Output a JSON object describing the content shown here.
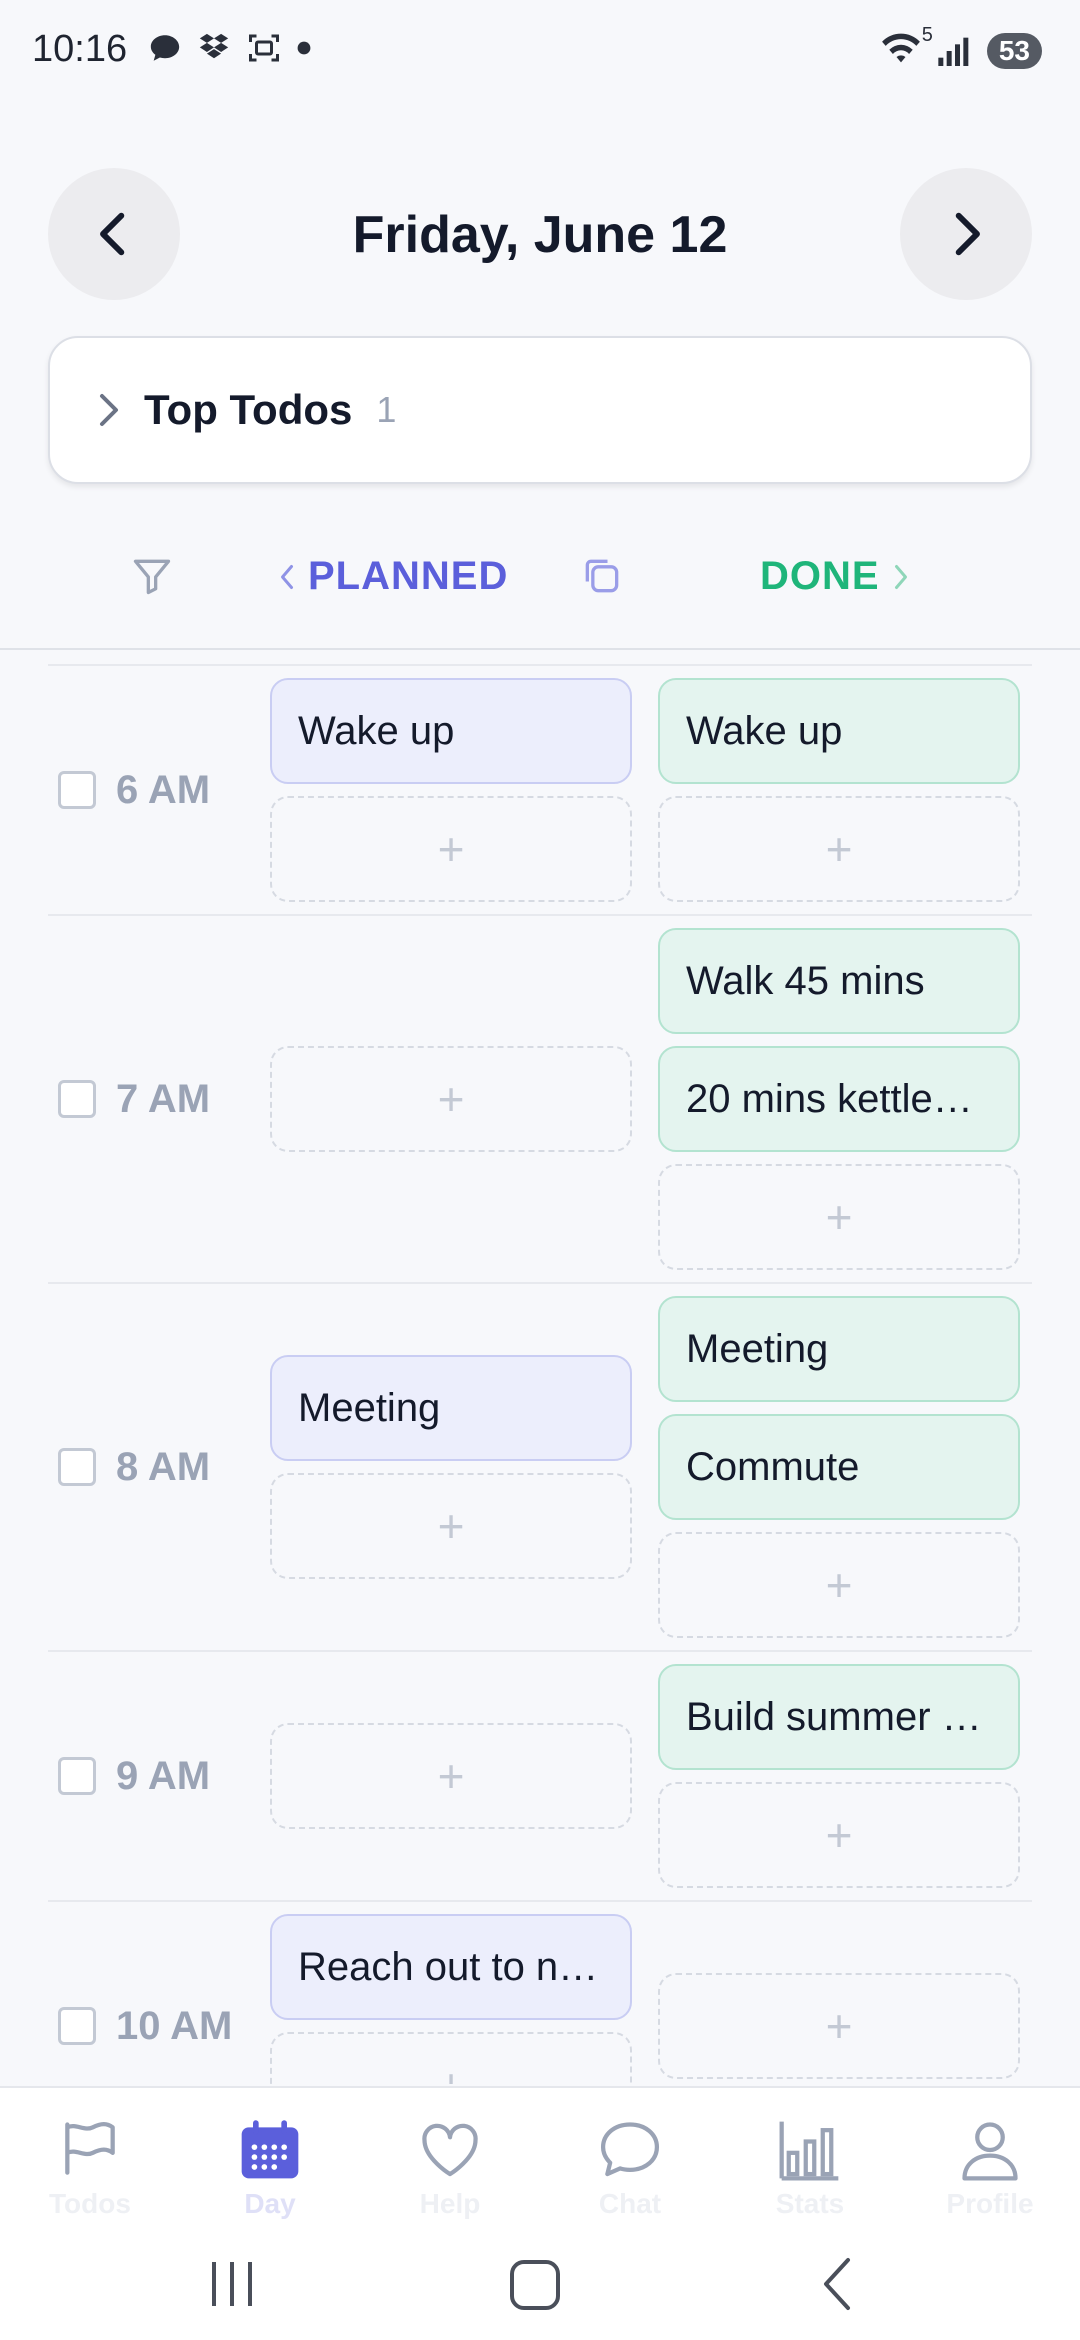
{
  "status_bar": {
    "time": "10:16",
    "battery": "53",
    "icons_left": [
      "chat-bubble-icon",
      "dropbox-icon",
      "screenshot-icon",
      "dot-icon"
    ],
    "icons_right": [
      "wifi-icon",
      "signal-icon",
      "battery-icon"
    ],
    "wifi_badge": "5"
  },
  "header": {
    "date": "Friday, June 12",
    "prev_icon": "chevron-left-icon",
    "next_icon": "chevron-right-icon"
  },
  "top_todos": {
    "label": "Top Todos",
    "count": "1"
  },
  "columns": {
    "planned_label": "PLANNED",
    "done_label": "DONE",
    "planned_color": "#5b5fdb",
    "done_color": "#1fb57a"
  },
  "add_symbol": "+",
  "hours": [
    {
      "label": "6 AM",
      "planned": [
        "Wake up"
      ],
      "done": [
        "Wake up"
      ]
    },
    {
      "label": "7 AM",
      "planned": [],
      "done": [
        "Walk 45 mins",
        "20 mins kettle…"
      ]
    },
    {
      "label": "8 AM",
      "planned": [
        "Meeting"
      ],
      "done": [
        "Meeting",
        "Commute"
      ]
    },
    {
      "label": "9 AM",
      "planned": [],
      "done": [
        "Build summer …"
      ]
    },
    {
      "label": "10 AM",
      "planned": [
        "Reach out to n…"
      ],
      "done": []
    }
  ],
  "bottom_nav": {
    "active": "day",
    "accent": "#5b5fdb",
    "items": [
      {
        "id": "todos",
        "label": "Todos",
        "icon": "flag-icon"
      },
      {
        "id": "day",
        "label": "Day",
        "icon": "calendar-icon"
      },
      {
        "id": "help",
        "label": "Help",
        "icon": "heart-icon"
      },
      {
        "id": "chat",
        "label": "Chat",
        "icon": "chat-icon"
      },
      {
        "id": "stats",
        "label": "Stats",
        "icon": "bar-chart-icon"
      },
      {
        "id": "profile",
        "label": "Profile",
        "icon": "person-icon"
      }
    ]
  }
}
